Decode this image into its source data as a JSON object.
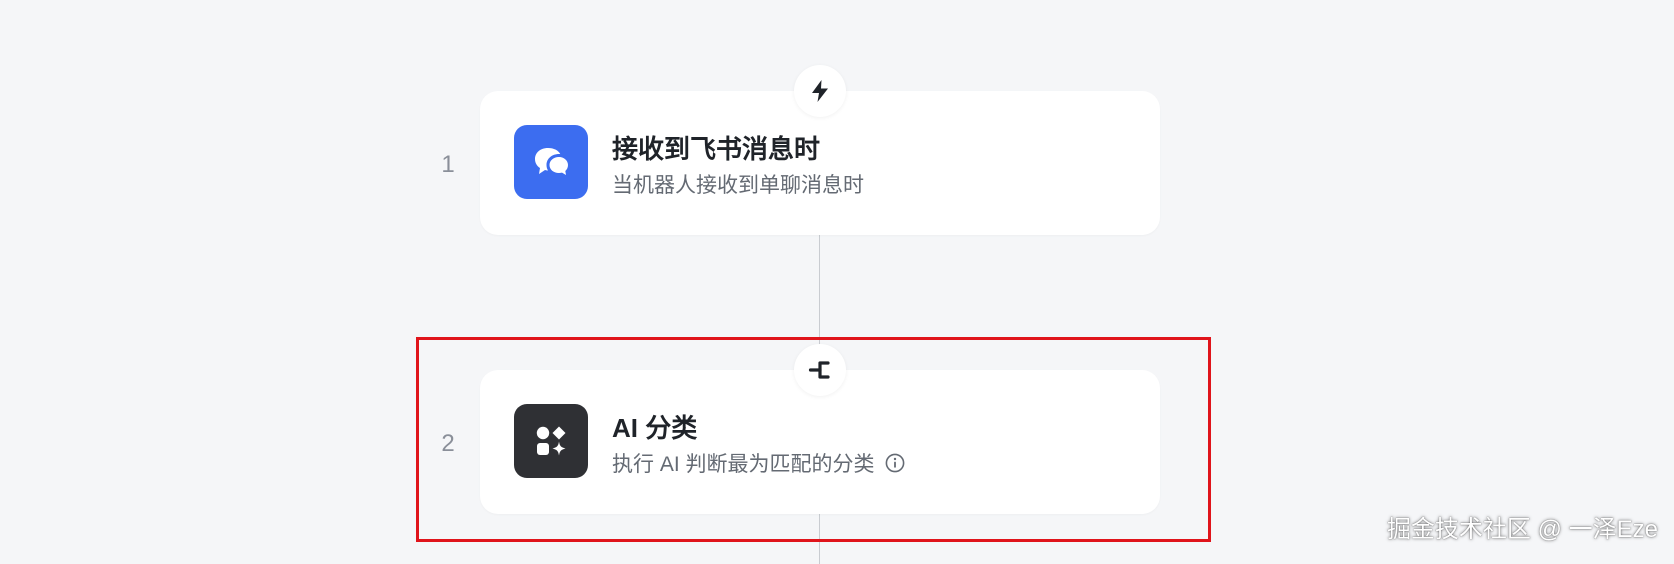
{
  "colors": {
    "background": "#f5f6f8",
    "trigger_icon_bg": "#3c6df0",
    "ai_icon_bg": "#2f3034",
    "highlight": "#e0141b"
  },
  "nodes": [
    {
      "step": "1",
      "title": "接收到飞书消息时",
      "description": "当机器人接收到单聊消息时",
      "icon": "chat-bubbles-icon",
      "badge_icon": "lightning-icon"
    },
    {
      "step": "2",
      "title": "AI 分类",
      "description": "执行 AI 判断最为匹配的分类",
      "icon": "shapes-sparkle-icon",
      "badge_icon": "branch-icon",
      "info_icon": "info-icon"
    }
  ],
  "watermark": "掘金技术社区 @ 一泽Eze"
}
